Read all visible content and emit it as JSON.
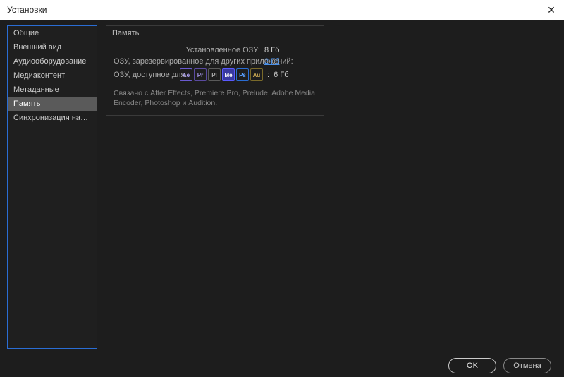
{
  "window": {
    "title": "Установки"
  },
  "sidebar": {
    "items": [
      {
        "label": "Общие"
      },
      {
        "label": "Внешний вид"
      },
      {
        "label": "Аудиооборудование"
      },
      {
        "label": "Медиаконтент"
      },
      {
        "label": "Метаданные"
      },
      {
        "label": "Память"
      },
      {
        "label": "Синхронизация настроек"
      }
    ],
    "selected_index": 5
  },
  "panel": {
    "title": "Память",
    "installed_label": "Установленное ОЗУ:",
    "installed_value": "8 Гб",
    "reserved_label": "ОЗУ, зарезервированное для других приложений:",
    "reserved_value": "2 Гб",
    "available_label": "ОЗУ, доступное для",
    "available_sep": ":",
    "available_value": "6 Гб",
    "apps": [
      {
        "code": "Ae",
        "cls": "ae"
      },
      {
        "code": "Pr",
        "cls": "pr"
      },
      {
        "code": "Pl",
        "cls": "pl"
      },
      {
        "code": "Me",
        "cls": "me"
      },
      {
        "code": "Ps",
        "cls": "ps"
      },
      {
        "code": "Au",
        "cls": "au"
      }
    ],
    "note": "Связано с After Effects, Premiere Pro, Prelude, Adobe Media Encoder, Photoshop и Audition."
  },
  "footer": {
    "ok": "OK",
    "cancel": "Отмена"
  }
}
